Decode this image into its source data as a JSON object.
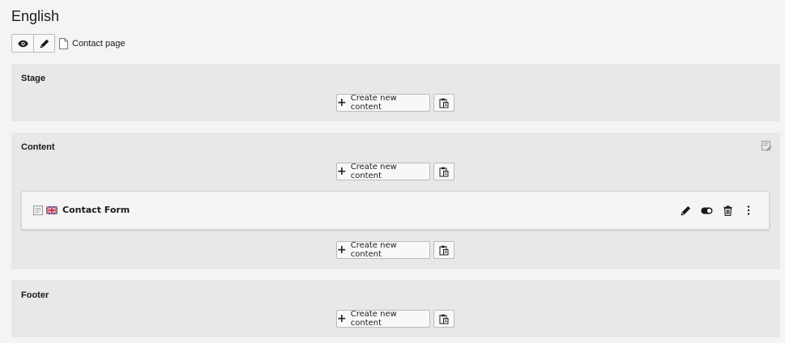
{
  "header": {
    "title": "English"
  },
  "toolbar": {
    "view_icon": "eye-icon",
    "edit_icon": "pencil-icon",
    "page_icon": "document-icon",
    "page_label": "Contact page"
  },
  "sections": {
    "stage": {
      "title": "Stage",
      "create_label": "Create new content",
      "paste_icon": "clipboard-paste-icon"
    },
    "content": {
      "title": "Content",
      "edit_column_icon": "edit-column-icon",
      "create_label_top": "Create new content",
      "create_label_bottom": "Create new content",
      "element": {
        "type_icon": "content-element-icon",
        "language_icon": "uk-flag-icon",
        "title": "Contact Form",
        "actions": [
          "pencil-icon",
          "toggle-icon",
          "trash-icon",
          "more-vertical-icon"
        ]
      }
    },
    "footer": {
      "title": "Footer",
      "create_label": "Create new content"
    }
  },
  "colors": {
    "background": "#f4f4f4",
    "section_bg": "#e8e8e8",
    "button_bg": "#f8f8f8",
    "border": "#bbbbbb"
  }
}
